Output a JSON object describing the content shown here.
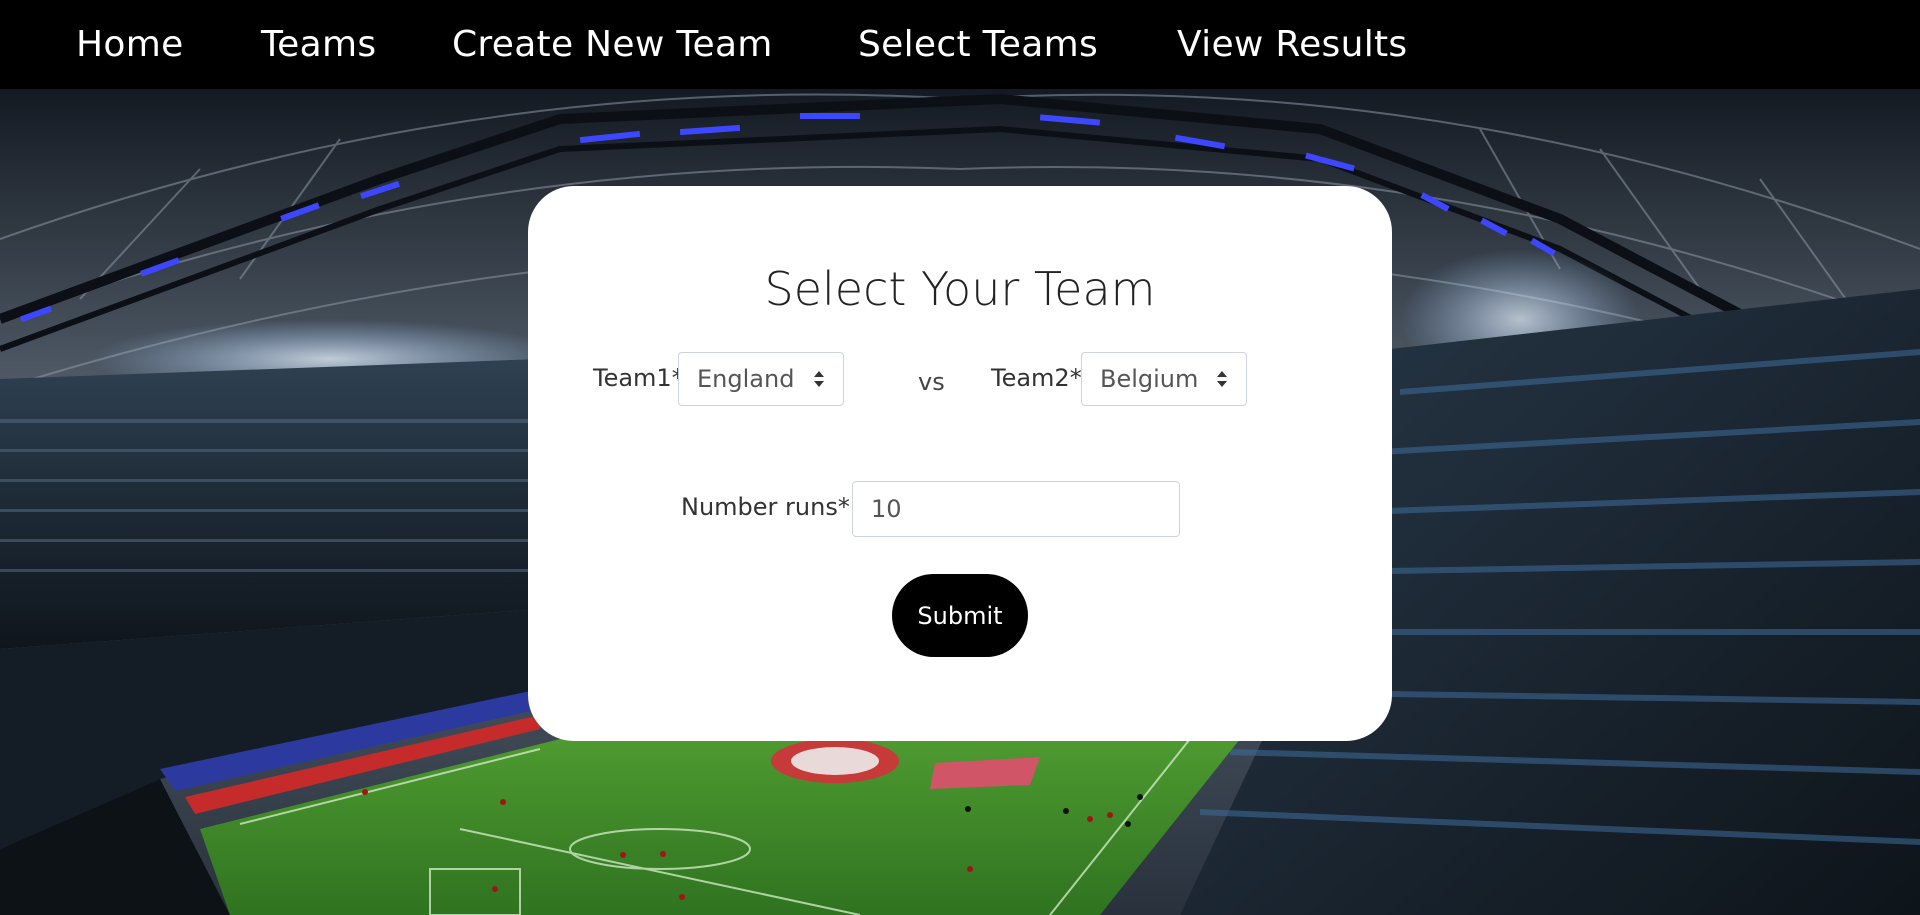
{
  "nav": {
    "home": "Home",
    "teams": "Teams",
    "create_new_team": "Create New Team",
    "select_teams": "Select Teams",
    "view_results": "View Results"
  },
  "form": {
    "title": "Select Your Team",
    "team1_label": "Team1*",
    "team1_value": "England",
    "vs_label": "vs",
    "team2_label": "Team2*",
    "team2_value": "Belgium",
    "runs_label": "Number runs*",
    "runs_value": "10",
    "submit_label": "Submit"
  },
  "icons": {
    "select_arrow": "sort-updown-icon"
  },
  "colors": {
    "navbar_bg": "#000000",
    "nav_text": "#ffffff",
    "card_bg": "#ffffff",
    "button_bg": "#000000",
    "button_text": "#ffffff",
    "pitch_green": "#3f8a2a",
    "stand_lights": "#2f3cff"
  }
}
